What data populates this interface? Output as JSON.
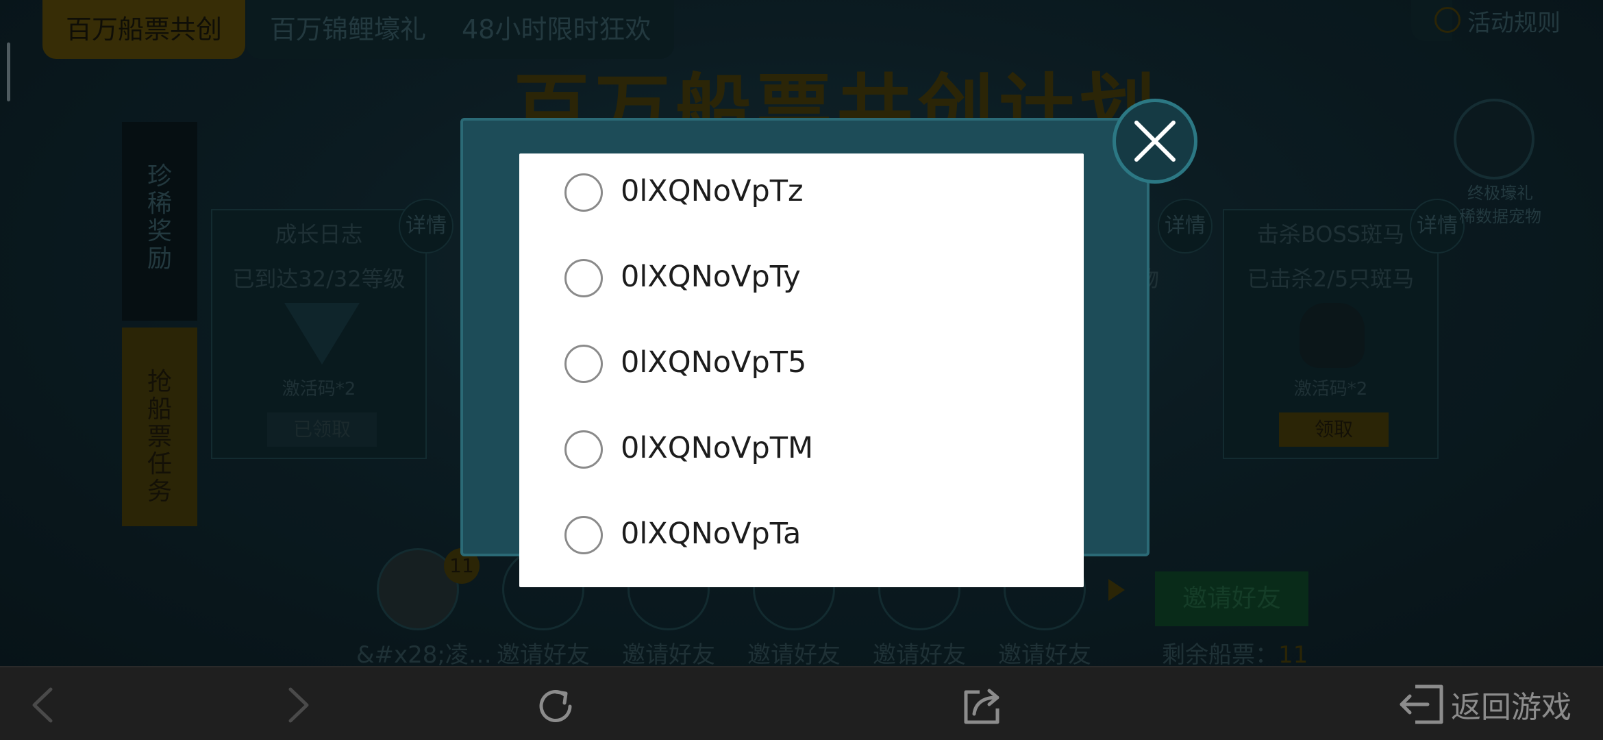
{
  "colors": {
    "sheet_bg": "#ffffff",
    "radio_border": "#8a8a8a",
    "option_text": "#1c1c1c",
    "navbar_bg": "#1f1f1f",
    "teal_dialog": "#1d4c58",
    "accent_gold": "#c8a010"
  },
  "tabs": [
    "百万船票共创",
    "百万锦鲤壕礼",
    "48小时限时狂欢"
  ],
  "rules_label": "活动规则",
  "page_title": "百万船票共创计划",
  "side_tabs": [
    "珍稀奖励",
    "抢船票任务"
  ],
  "cards": [
    {
      "title": "成长日志",
      "sub": "已到达32/32等级",
      "code": "激活码*2",
      "button": "已领取"
    },
    {
      "title": "击杀BOSS斑马",
      "sub": "已击杀2/5只斑马",
      "code": "激活码*2",
      "button": "领取"
    }
  ],
  "detail_label": "详情",
  "mid_fragment": "物",
  "ultimate_reward": [
    "终极壕礼",
    "稀数据宠物"
  ],
  "friends": {
    "first_name": "&#x28;凌…",
    "first_badge": "11",
    "invite_label": "邀请好友",
    "invite_button": "邀请好友",
    "tickets_label": "剩余船票：",
    "tickets_value": "11"
  },
  "dialog": {
    "close_icon": "close-icon",
    "options": [
      {
        "label": "0lXQNoVpTz",
        "selected": false
      },
      {
        "label": "0lXQNoVpTy",
        "selected": false
      },
      {
        "label": "0lXQNoVpT5",
        "selected": false
      },
      {
        "label": "0lXQNoVpTM",
        "selected": false
      },
      {
        "label": "0lXQNoVpTa",
        "selected": false
      }
    ]
  },
  "navbar": {
    "back_icon": "chevron-left-icon",
    "forward_icon": "chevron-right-icon",
    "refresh_icon": "refresh-icon",
    "share_icon": "share-icon",
    "return_icon": "exit-icon",
    "return_label": "返回游戏"
  }
}
